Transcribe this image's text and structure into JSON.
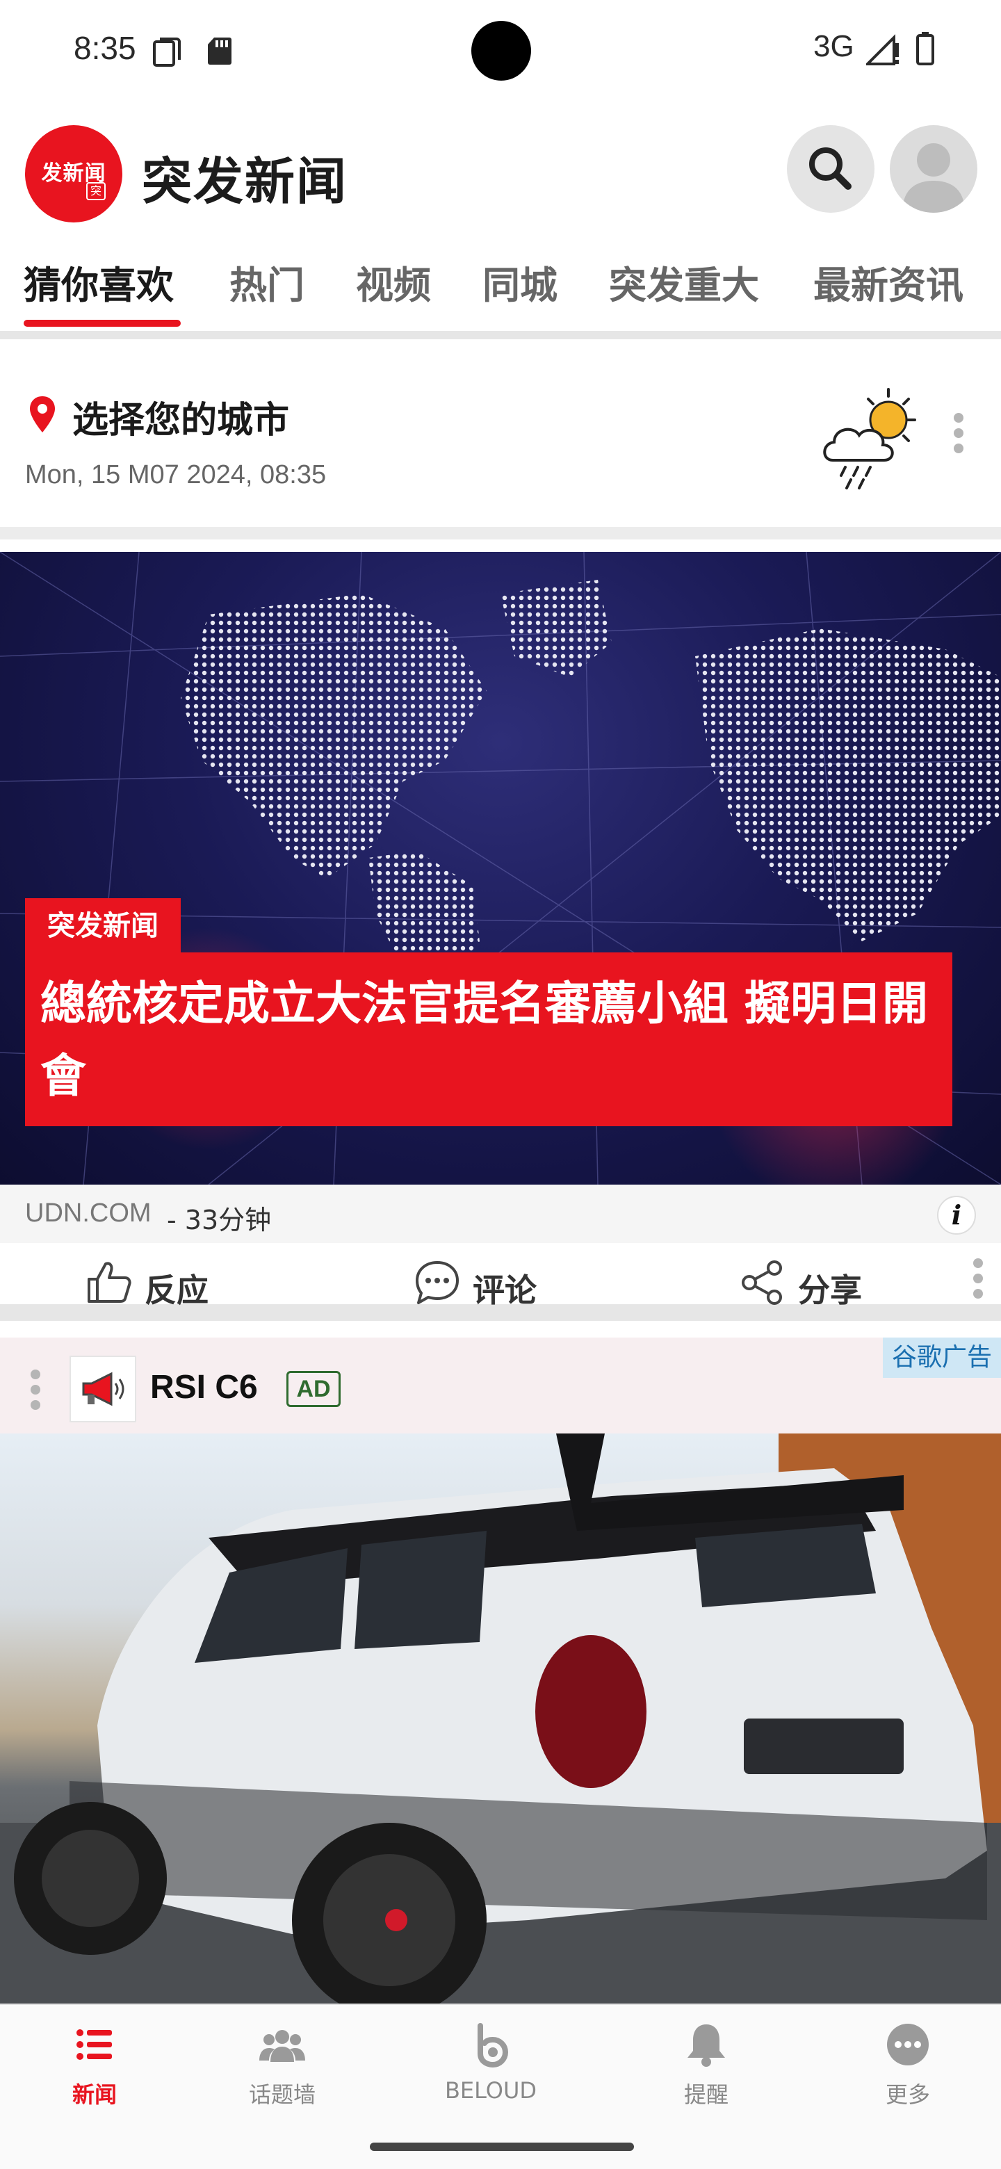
{
  "status_bar": {
    "time": "8:35",
    "network": "3G",
    "icons": [
      "screen-copy-icon",
      "sd-card-icon",
      "signal-icon",
      "battery-icon"
    ]
  },
  "app": {
    "logo_text": "发新闻",
    "logo_badge": "突",
    "title": "突发新闻",
    "brand_color": "#e8141f"
  },
  "tabs": [
    {
      "label": "猜你喜欢",
      "active": true
    },
    {
      "label": "热门",
      "active": false
    },
    {
      "label": "视频",
      "active": false
    },
    {
      "label": "同城",
      "active": false
    },
    {
      "label": "突发重大",
      "active": false
    },
    {
      "label": "最新资讯",
      "active": false
    }
  ],
  "weather": {
    "city_label": "选择您的城市",
    "datetime": "Mon, 15 M07 2024, 08:35",
    "icon": "cloud-sun-rain-icon"
  },
  "hero": {
    "tag": "突发新闻",
    "title": "總統核定成立大法官提名審薦小組 擬明日開會",
    "source": "UDN.COM",
    "time": "- 33分钟",
    "info": "i"
  },
  "actions": {
    "react": "反应",
    "comment": "评论",
    "share": "分享"
  },
  "ad": {
    "google_label": "谷歌广告",
    "advertiser": "RSI C6",
    "badge": "AD"
  },
  "bottom_nav": [
    {
      "label": "新闻",
      "icon": "news-list-icon",
      "active": true
    },
    {
      "label": "话题墙",
      "icon": "community-icon",
      "active": false
    },
    {
      "label": "BELOUD",
      "icon": "beloud-icon",
      "active": false
    },
    {
      "label": "提醒",
      "icon": "bell-icon",
      "active": false
    },
    {
      "label": "更多",
      "icon": "more-icon",
      "active": false
    }
  ]
}
